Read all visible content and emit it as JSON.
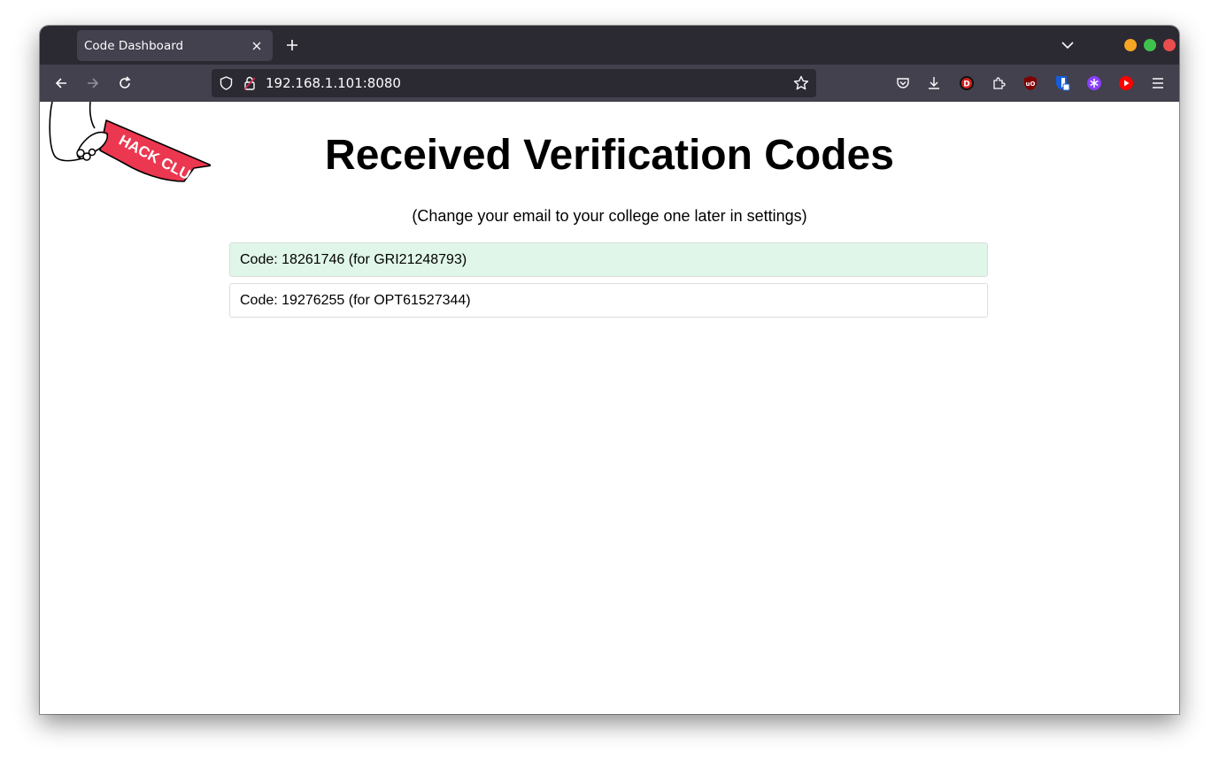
{
  "browser": {
    "tab_title": "Code Dashboard",
    "url": "192.168.1.101:8080",
    "window_controls": {
      "minimize_color": "#f6a623",
      "maximize_color": "#3fc24d",
      "close_color": "#ea4d4d"
    }
  },
  "page": {
    "logo_text": "HACK CLUB",
    "title": "Received Verification Codes",
    "subtitle": "(Change your email to your college one later in settings)",
    "codes": [
      {
        "text": "Code: 18261746 (for GRI21248793)",
        "highlighted": true,
        "background": "#e0f6e9"
      },
      {
        "text": "Code: 19276255 (for OPT61527344)",
        "highlighted": false,
        "background": "#ffffff"
      }
    ]
  },
  "extensions": [
    "pocket-icon",
    "download-icon",
    "dashlane-icon",
    "extensions-icon",
    "ublock-icon",
    "bitwarden-icon",
    "snowflake-extension-icon",
    "youtube-icon",
    "menu-icon"
  ]
}
